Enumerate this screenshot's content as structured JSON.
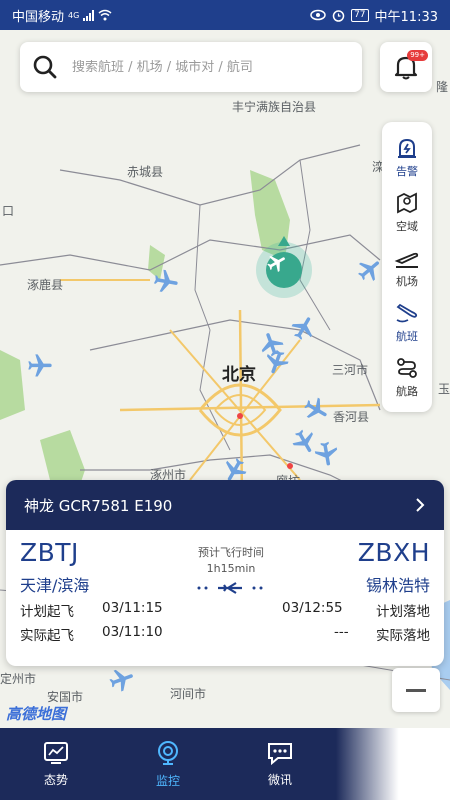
{
  "status_bar": {
    "carrier": "中国移动",
    "network": "4G",
    "battery": "77",
    "time": "中午11:33"
  },
  "search": {
    "placeholder": "搜索航班 / 机场 / 城市对 / 航司",
    "icon": "search-icon"
  },
  "notifications": {
    "badge": "99+",
    "icon": "bell-icon"
  },
  "map": {
    "places": [
      "丰宁满族自治县",
      "赤城县",
      "涿鹿县",
      "北京",
      "三河市",
      "香河县",
      "廊坊",
      "涿州市",
      "安国市",
      "河间市",
      "滦",
      "隆",
      "玉",
      "口",
      "定州市"
    ],
    "logo": "高德地图"
  },
  "tools": [
    {
      "label": "告警",
      "icon": "alert-icon",
      "active": true
    },
    {
      "label": "空域",
      "icon": "airspace-icon",
      "active": false
    },
    {
      "label": "机场",
      "icon": "airport-icon",
      "active": false
    },
    {
      "label": "航班",
      "icon": "flight-icon",
      "active": true
    },
    {
      "label": "航路",
      "icon": "route-icon",
      "active": false
    }
  ],
  "flight_card": {
    "header": "神龙 GCR7581 E190",
    "origin_code": "ZBTJ",
    "origin_city": "天津/滨海",
    "dest_code": "ZBXH",
    "dest_city": "锡林浩特",
    "duration_label": "预计飞行时间",
    "duration": "1h15min",
    "planned_dep_label": "计划起飞",
    "planned_dep": "03/11:15",
    "actual_dep_label": "实际起飞",
    "actual_dep": "03/11:10",
    "planned_arr_label": "计划落地",
    "planned_arr": "03/12:55",
    "actual_arr_label": "实际落地",
    "actual_arr": "---"
  },
  "nav": [
    {
      "label": "态势",
      "icon": "situation-icon",
      "active": false
    },
    {
      "label": "监控",
      "icon": "monitor-icon",
      "active": true
    },
    {
      "label": "微讯",
      "icon": "message-icon",
      "active": false
    }
  ],
  "colors": {
    "primary": "#1f3f8c",
    "nav_bg": "#1c2a5a",
    "active_nav": "#4fb7ff",
    "alert_badge": "#e63b3b"
  }
}
